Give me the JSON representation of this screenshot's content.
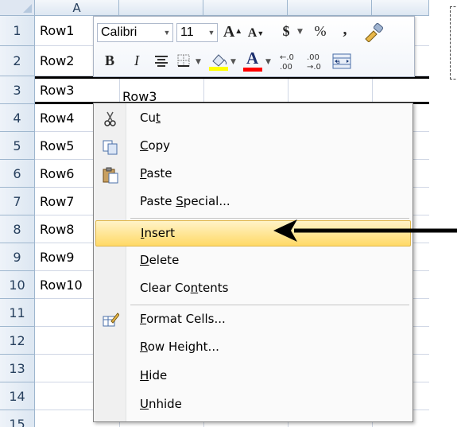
{
  "sheet": {
    "column_a": "A",
    "rows": [
      {
        "num": "1",
        "a": "Row1"
      },
      {
        "num": "2",
        "a": "Row2"
      },
      {
        "num": "3",
        "a": "Row3"
      },
      {
        "num": "4",
        "a": "Row4"
      },
      {
        "num": "5",
        "a": "Row5"
      },
      {
        "num": "6",
        "a": "Row6"
      },
      {
        "num": "7",
        "a": "Row7"
      },
      {
        "num": "8",
        "a": "Row8"
      },
      {
        "num": "9",
        "a": "Row9"
      },
      {
        "num": "10",
        "a": "Row10"
      },
      {
        "num": "11",
        "a": ""
      },
      {
        "num": "12",
        "a": ""
      },
      {
        "num": "13",
        "a": ""
      },
      {
        "num": "14",
        "a": ""
      },
      {
        "num": "15",
        "a": ""
      }
    ],
    "row3_b": "Row3"
  },
  "mini_toolbar": {
    "font_name": "Calibri",
    "font_size": "11",
    "grow_font": "A",
    "shrink_font": "A",
    "currency": "$",
    "percent": "%",
    "comma": ",",
    "bold": "B",
    "italic": "I",
    "font_color_letter": "A",
    "increase_decimal": "←.0\n.00",
    "decrease_decimal": ".00\n→.0",
    "highlight_color": "#ffff00",
    "font_color": "#ff0000"
  },
  "context_menu": {
    "cut": {
      "pre": "Cu",
      "u": "t",
      "post": ""
    },
    "copy": {
      "pre": "",
      "u": "C",
      "post": "opy"
    },
    "paste": {
      "pre": "",
      "u": "P",
      "post": "aste"
    },
    "paste_special": {
      "pre": "Paste ",
      "u": "S",
      "post": "pecial..."
    },
    "insert": {
      "pre": "",
      "u": "I",
      "post": "nsert"
    },
    "delete": {
      "pre": "",
      "u": "D",
      "post": "elete"
    },
    "clear_contents": {
      "pre": "Clear Co",
      "u": "n",
      "post": "tents"
    },
    "format_cells": {
      "pre": "",
      "u": "F",
      "post": "ormat Cells..."
    },
    "row_height": {
      "pre": "",
      "u": "R",
      "post": "ow Height..."
    },
    "hide": {
      "pre": "",
      "u": "H",
      "post": "ide"
    },
    "unhide": {
      "pre": "",
      "u": "U",
      "post": "nhide"
    },
    "highlight_item": "insert"
  }
}
